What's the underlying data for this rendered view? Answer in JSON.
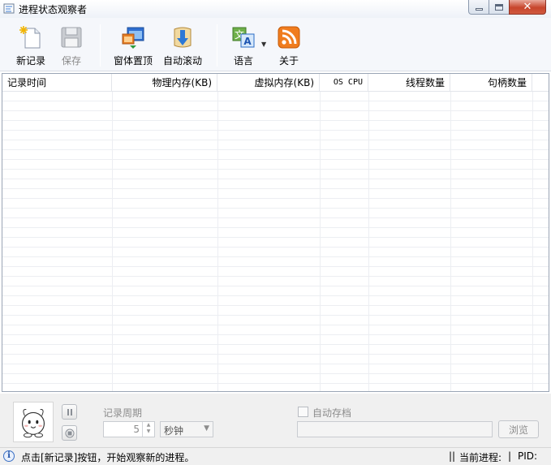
{
  "window": {
    "title": "进程状态观察者"
  },
  "toolbar": {
    "new_record": "新记录",
    "save": "保存",
    "topmost": "窗体置顶",
    "autoscroll": "自动滚动",
    "language": "语言",
    "about": "关于"
  },
  "list": {
    "columns": [
      "记录时间",
      "物理内存(KB)",
      "虚拟内存(KB)",
      "OS CPU",
      "线程数量",
      "句柄数量"
    ]
  },
  "panel": {
    "period_label": "记录周期",
    "period_value": "5",
    "period_unit": "秒钟",
    "autosave_label": "自动存档",
    "path_value": "",
    "browse_label": "浏览"
  },
  "status": {
    "message": "点击[新记录]按钮，开始观察新的进程。",
    "sep1": "||",
    "current_process_label": "当前进程:",
    "sep2": "|",
    "pid_label": "PID:"
  },
  "icons": {
    "app": "app-icon",
    "new": "new-document-icon",
    "save": "floppy-disk-icon",
    "topmost": "window-pin-icon",
    "autoscroll": "scroll-down-icon",
    "language": "translate-icon",
    "about": "rss-icon",
    "pause": "pause-icon",
    "stop": "stop-icon",
    "info": "info-icon"
  }
}
